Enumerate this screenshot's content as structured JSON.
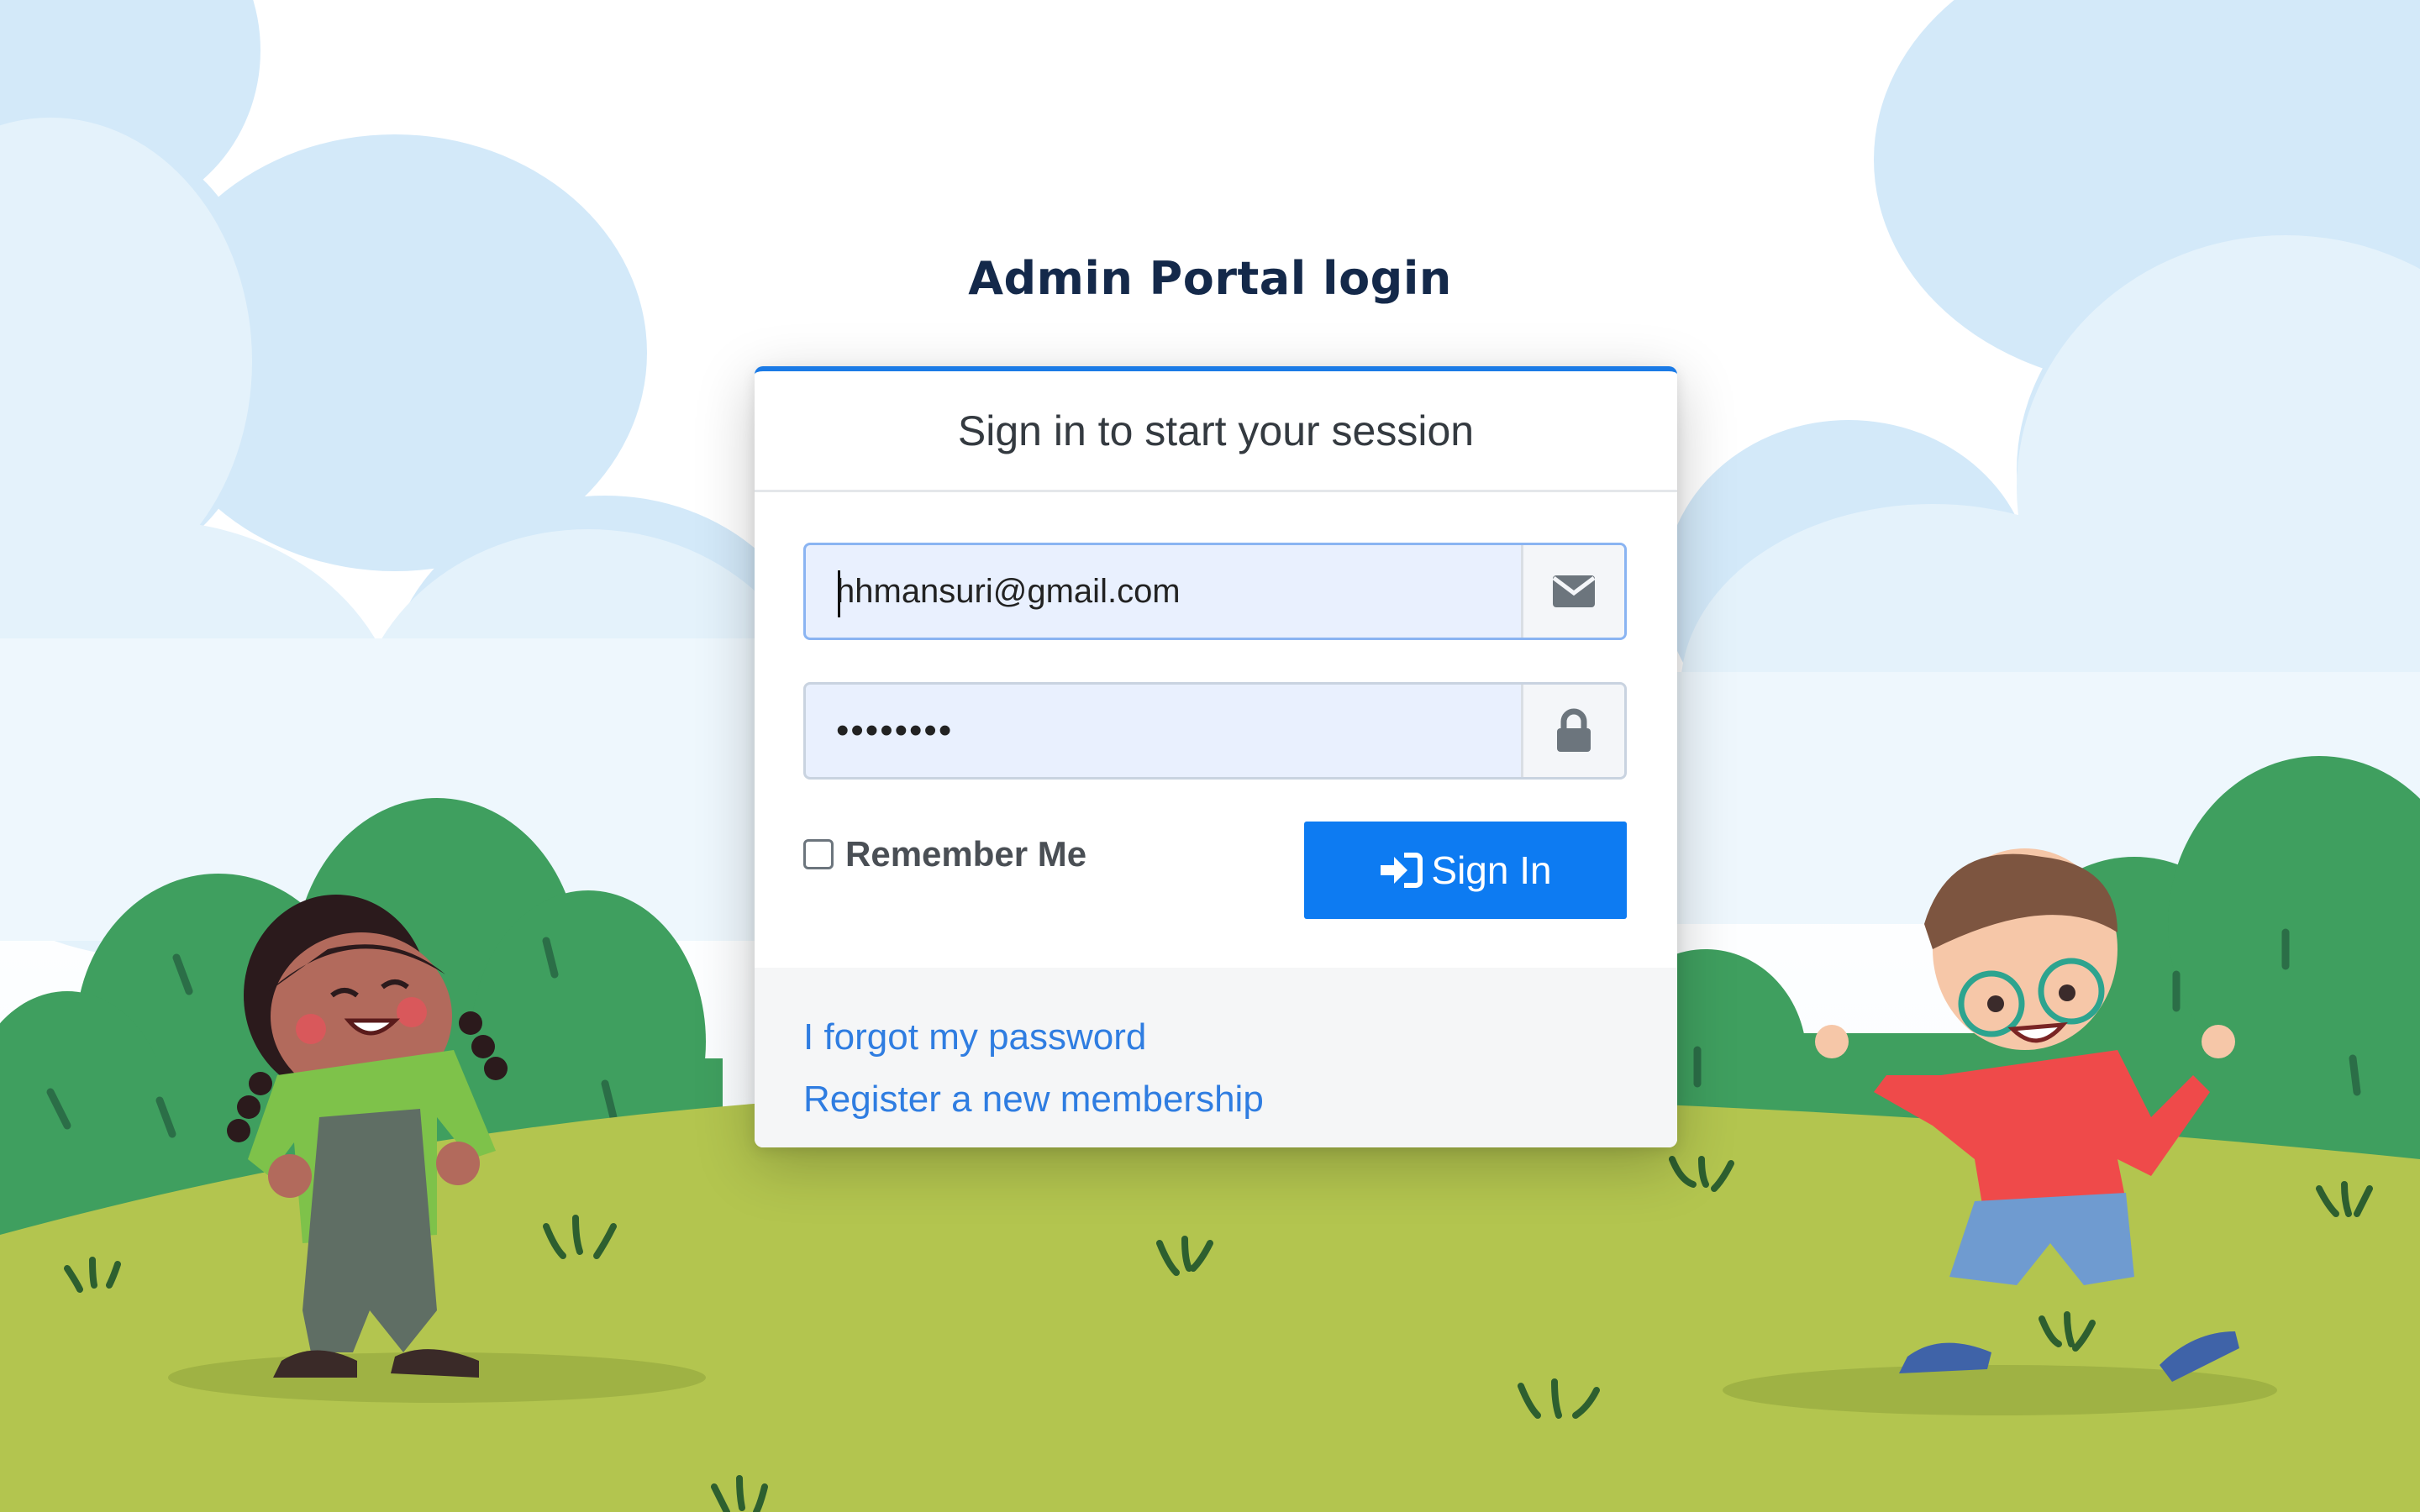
{
  "page": {
    "title": "Admin Portal login"
  },
  "login_card": {
    "header": "Sign in to start your session",
    "email": {
      "value": "hhmansuri@gmail.com",
      "icon": "envelope-icon"
    },
    "password": {
      "masked_value": "••••••••",
      "icon": "lock-icon"
    },
    "remember_me": {
      "label": "Remember Me",
      "checked": false
    },
    "sign_in_button": {
      "label": "Sign In",
      "icon": "sign-in-icon"
    },
    "links": {
      "forgot_password": "I forgot my password",
      "register": "Register a new membership"
    },
    "colors": {
      "accent": "#0d7bf2",
      "link": "#2f7de1",
      "title": "#14294a"
    }
  },
  "background": {
    "description_icons": [
      "cloud-illustration",
      "bush-illustration",
      "girl-character",
      "boy-character"
    ]
  }
}
